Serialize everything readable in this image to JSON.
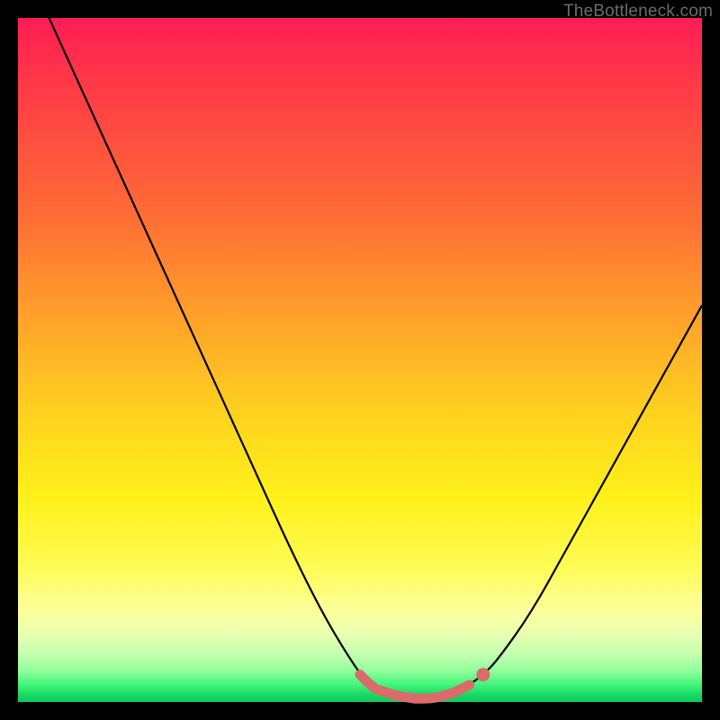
{
  "watermark": "TheBottleneck.com",
  "colors": {
    "frame": "#000000",
    "curve_stroke": "#000000",
    "highlight_stroke": "#d96b6b",
    "highlight_dot": "#d96b6b",
    "gradient_stops": [
      "#ff1c54",
      "#ff3a47",
      "#ff6a36",
      "#ffa629",
      "#ffd21f",
      "#fff01a",
      "#fffb52",
      "#fcff9e",
      "#e9ffb0",
      "#c4ffb0",
      "#8fff9c",
      "#43f47a",
      "#17d864",
      "#0ecb5a"
    ]
  },
  "chart_data": {
    "type": "line",
    "title": "",
    "xlabel": "",
    "ylabel": "",
    "xlim": [
      0,
      100
    ],
    "ylim": [
      0,
      100
    ],
    "x": [
      0,
      5,
      10,
      15,
      20,
      25,
      30,
      35,
      40,
      45,
      50,
      52,
      55,
      58,
      60,
      62,
      64,
      66,
      68,
      70,
      75,
      80,
      85,
      90,
      95,
      100
    ],
    "values": [
      110,
      99,
      88,
      77,
      66,
      55,
      44,
      33,
      22,
      12,
      4,
      2,
      1,
      0.5,
      0.5,
      0.8,
      1.5,
      2.5,
      4,
      6,
      13,
      22,
      31,
      40,
      49,
      58
    ],
    "highlight_range_x": [
      50,
      66
    ],
    "highlight_dot_x": 68,
    "note": "V-shaped bottleneck curve with flat green minimum band; values are percent-of-height estimates read off the gradient axis (0 = bottom green, 100 = top red)."
  }
}
